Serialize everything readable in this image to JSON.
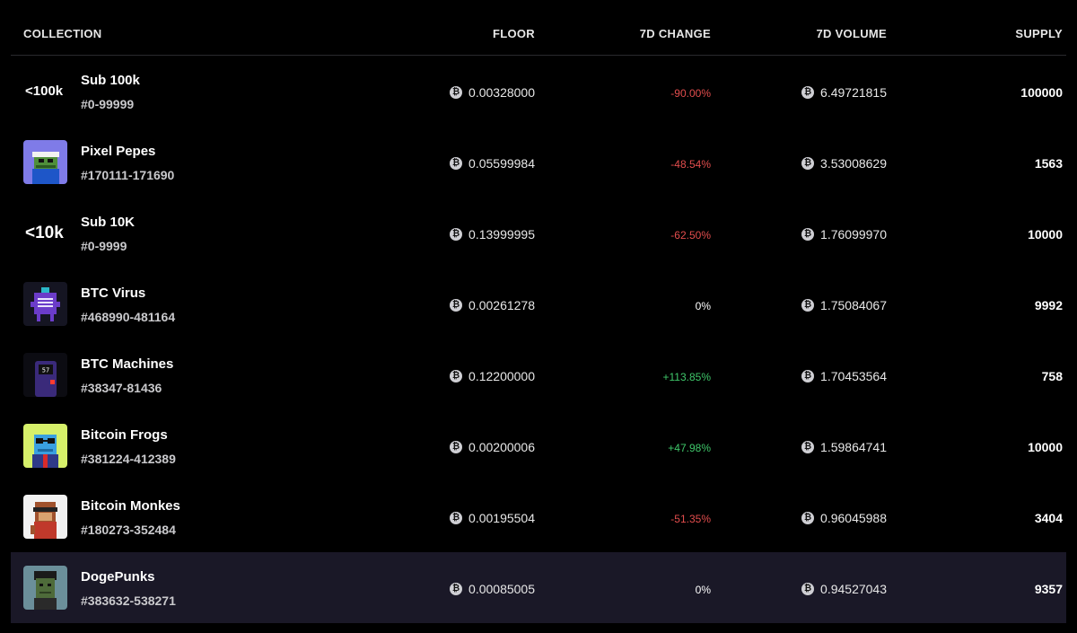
{
  "header": {
    "collection": "COLLECTION",
    "floor": "FLOOR",
    "change": "7D CHANGE",
    "volume": "7D VOLUME",
    "supply": "SUPPLY"
  },
  "currency_icon": "bitcoin-icon",
  "colors": {
    "negative": "#e24d4d",
    "positive": "#3fc76a",
    "highlight_row": "#1a1827"
  },
  "rows": [
    {
      "thumb_text": "<100k",
      "name": "Sub 100k",
      "range": "#0-99999",
      "floor": "0.00328000",
      "change": "-90.00%",
      "change_trend": "negative",
      "volume": "6.49721815",
      "supply": "100000"
    },
    {
      "thumb_icon": "pixel-pepe-icon",
      "name": "Pixel Pepes",
      "range": "#170111-171690",
      "floor": "0.05599984",
      "change": "-48.54%",
      "change_trend": "negative",
      "volume": "3.53008629",
      "supply": "1563"
    },
    {
      "thumb_text": "<10k",
      "name": "Sub 10K",
      "range": "#0-9999",
      "floor": "0.13999995",
      "change": "-62.50%",
      "change_trend": "negative",
      "volume": "1.76099970",
      "supply": "10000"
    },
    {
      "thumb_icon": "btc-virus-icon",
      "name": "BTC Virus",
      "range": "#468990-481164",
      "floor": "0.00261278",
      "change": "0%",
      "change_trend": "neutral",
      "volume": "1.75084067",
      "supply": "9992"
    },
    {
      "thumb_icon": "btc-machine-icon",
      "thumb_label": "57",
      "name": "BTC Machines",
      "range": "#38347-81436",
      "floor": "0.12200000",
      "change": "+113.85%",
      "change_trend": "positive",
      "volume": "1.70453564",
      "supply": "758"
    },
    {
      "thumb_icon": "bitcoin-frog-icon",
      "name": "Bitcoin Frogs",
      "range": "#381224-412389",
      "floor": "0.00200006",
      "change": "+47.98%",
      "change_trend": "positive",
      "volume": "1.59864741",
      "supply": "10000"
    },
    {
      "thumb_icon": "bitcoin-monke-icon",
      "name": "Bitcoin Monkes",
      "range": "#180273-352484",
      "floor": "0.00195504",
      "change": "-51.35%",
      "change_trend": "negative",
      "volume": "0.96045988",
      "supply": "3404"
    },
    {
      "thumb_icon": "dogepunk-icon",
      "name": "DogePunks",
      "range": "#383632-538271",
      "floor": "0.00085005",
      "change": "0%",
      "change_trend": "neutral",
      "volume": "0.94527043",
      "supply": "9357",
      "highlighted": true
    }
  ]
}
